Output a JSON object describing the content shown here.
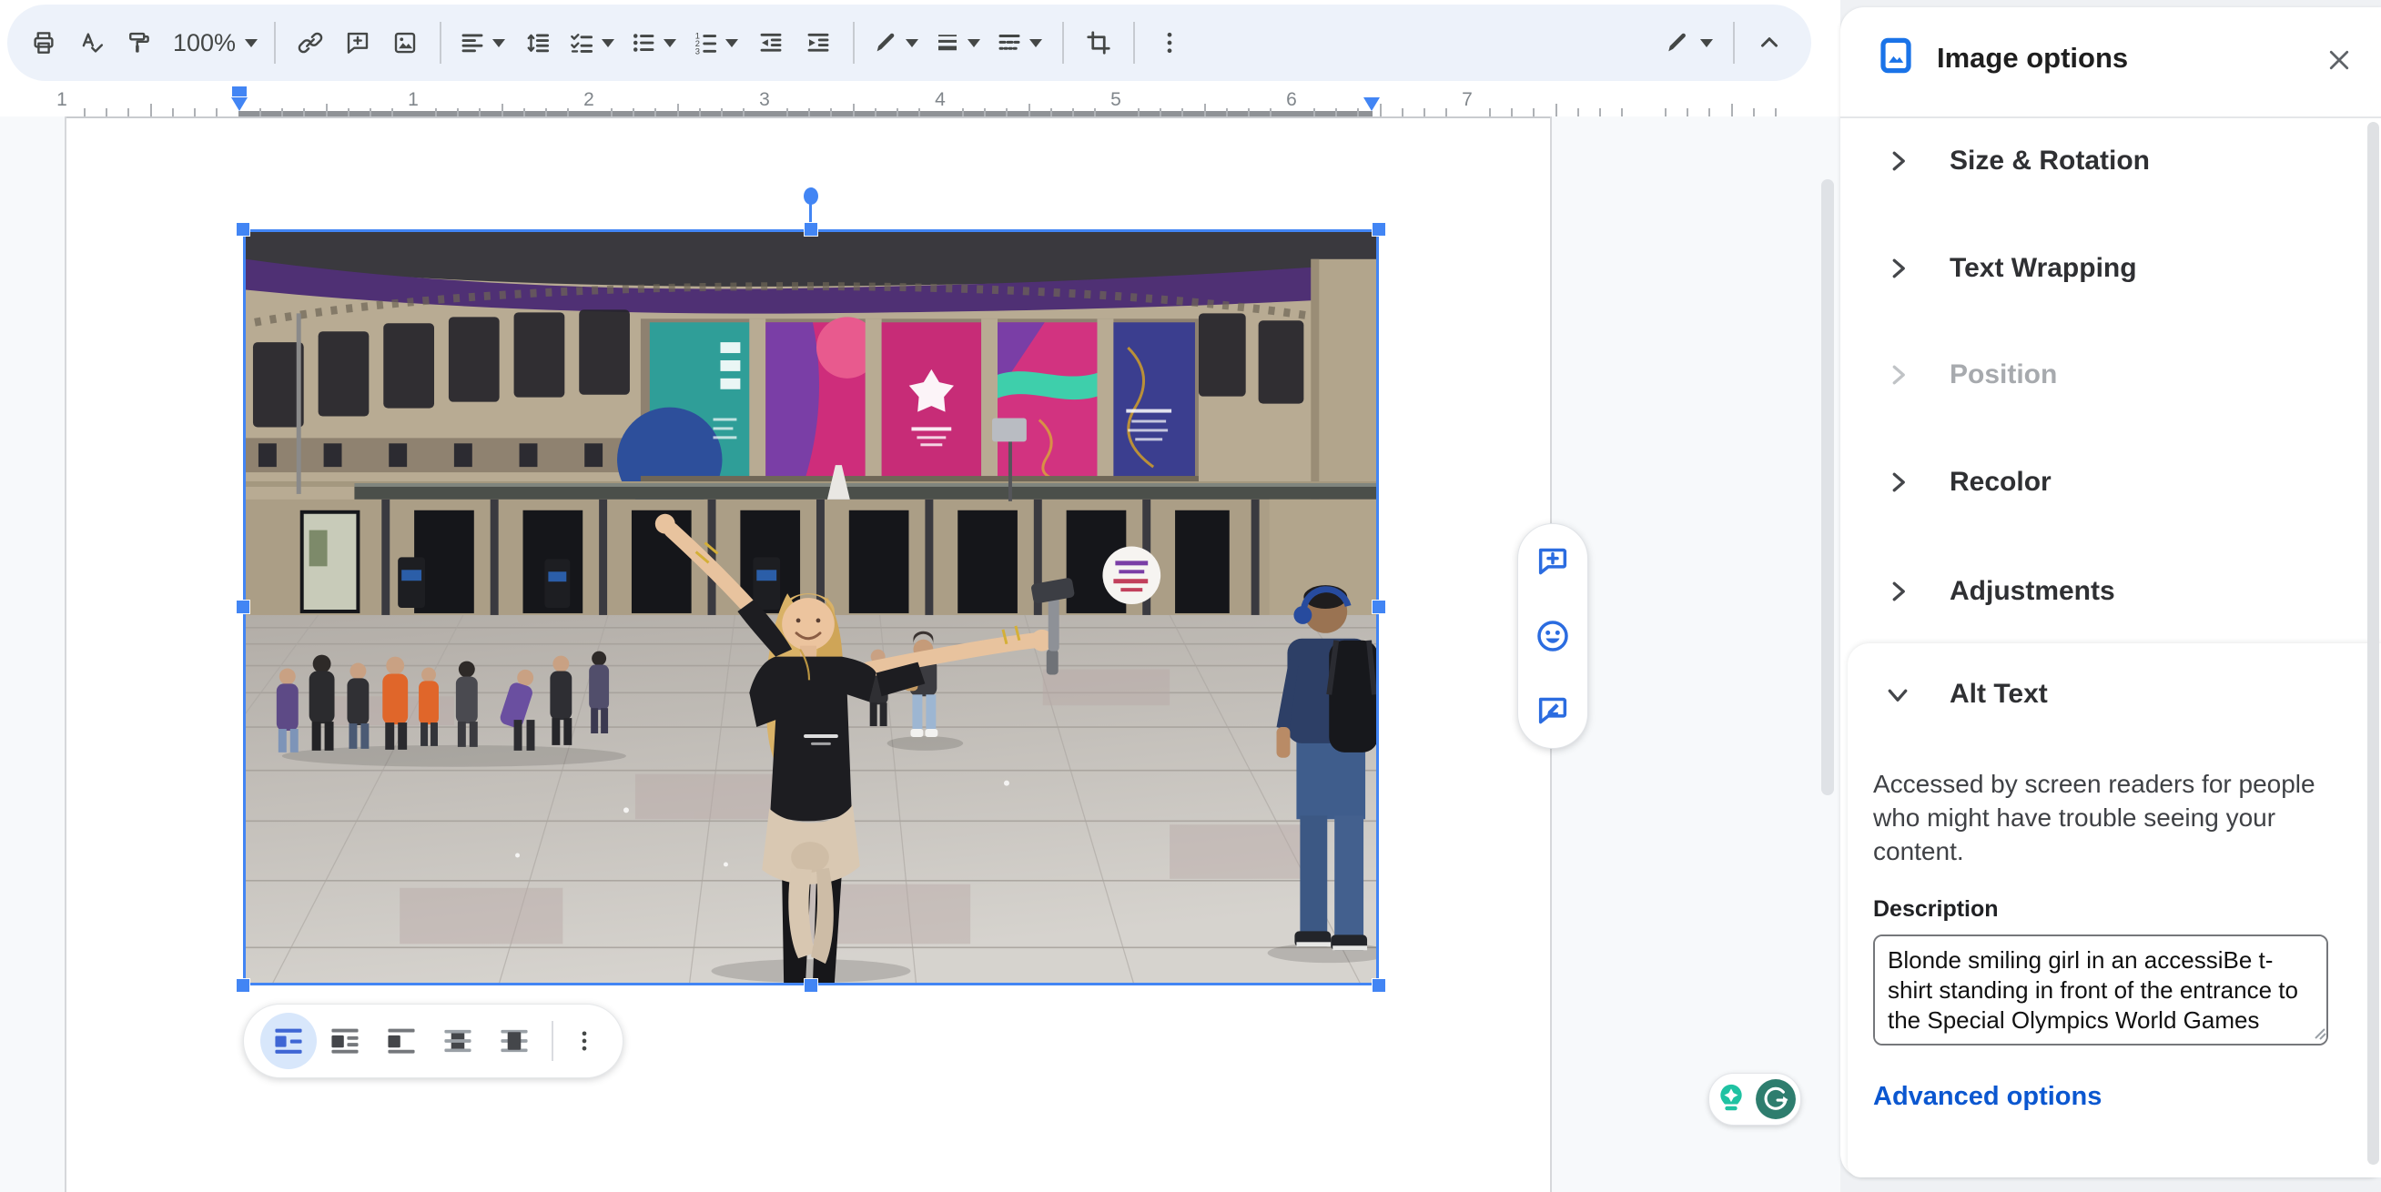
{
  "toolbar": {
    "zoom_value": "100%",
    "icons": [
      "print",
      "spell-check",
      "paint-format",
      "zoom",
      "insert-link",
      "add-comment",
      "insert-image",
      "align",
      "line-spacing",
      "checklist",
      "bulleted-list",
      "numbered-list",
      "decrease-indent",
      "increase-indent",
      "border-color",
      "border-weight",
      "border-dash",
      "crop-image",
      "more-options",
      "editing-mode",
      "hide-menus"
    ]
  },
  "ruler": {
    "labels": [
      "1",
      "",
      "1",
      "2",
      "3",
      "4",
      "5",
      "6",
      "7"
    ]
  },
  "image_toolbar": {
    "options": [
      "in-line",
      "wrap-text",
      "break-text",
      "behind-text",
      "in-front-of-text"
    ],
    "selected": "in-line",
    "more": "more-image-options"
  },
  "side_actions": [
    "add-comment",
    "add-emoji-reaction",
    "suggest-edits"
  ],
  "grammarly": {
    "icons": [
      "lightbulb-suggestion",
      "grammarly-logo"
    ]
  },
  "panel": {
    "title": "Image options",
    "sections": [
      {
        "label": "Size & Rotation",
        "state": "collapsed"
      },
      {
        "label": "Text Wrapping",
        "state": "collapsed"
      },
      {
        "label": "Position",
        "state": "disabled"
      },
      {
        "label": "Recolor",
        "state": "collapsed"
      },
      {
        "label": "Adjustments",
        "state": "collapsed"
      },
      {
        "label": "Alt Text",
        "state": "expanded"
      }
    ],
    "alt_text": {
      "helper_lines": [
        "Accessed by screen readers for people",
        "who might have trouble seeing your",
        "content."
      ],
      "description_label": "Description",
      "description_value": "Blonde smiling girl in an accessiBe t-\nshirt standing in front of the entrance to\nthe Special Olympics World Games",
      "advanced_link": "Advanced options"
    }
  },
  "photo": {
    "scene": "Blonde smiling girl in a black accessiBe t-shirt, arms outstretched holding a camera gimbal, standing in front of the Special Olympics World Games stadium entrance with teal, magenta and purple banners"
  },
  "colors": {
    "accent_blue": "#4285f4",
    "toolbar_bg": "#edf2fa",
    "link_blue": "#0b57d0",
    "selected_wrap_bg": "#d8e7fb",
    "grammarly_teal": "#1fc2a2",
    "grammarly_green": "#2e7d6e",
    "banner_teal": "#2f9e98",
    "banner_magenta": "#ce2d7b",
    "banner_indigo": "#3b3e8f"
  }
}
